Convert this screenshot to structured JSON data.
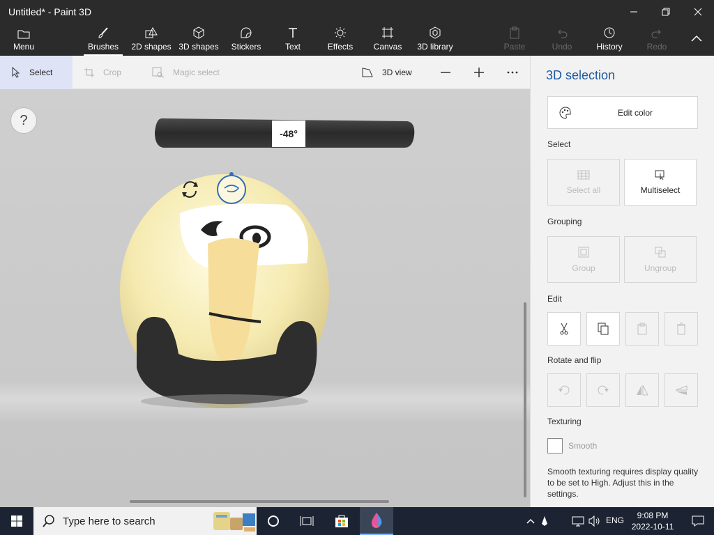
{
  "window": {
    "title": "Untitled* - Paint 3D"
  },
  "ribbon": {
    "menu": "Menu",
    "tools": [
      "Brushes",
      "2D shapes",
      "3D shapes",
      "Stickers",
      "Text",
      "Effects",
      "Canvas",
      "3D library"
    ],
    "actions": {
      "paste": "Paste",
      "undo": "Undo",
      "history": "History",
      "redo": "Redo"
    }
  },
  "toolbar": {
    "select": "Select",
    "crop": "Crop",
    "magic_select": "Magic select",
    "view_3d": "3D view"
  },
  "canvas": {
    "help": "?",
    "rotation_angle": "-48°"
  },
  "panel": {
    "title": "3D selection",
    "edit_color": "Edit color",
    "select_label": "Select",
    "select_all": "Select all",
    "multiselect": "Multiselect",
    "grouping_label": "Grouping",
    "group": "Group",
    "ungroup": "Ungroup",
    "edit_label": "Edit",
    "rotate_flip_label": "Rotate and flip",
    "texturing_label": "Texturing",
    "smooth": "Smooth",
    "smooth_note": "Smooth texturing requires display quality to be set to High. Adjust this in the settings."
  },
  "taskbar": {
    "search_placeholder": "Type here to search",
    "language": "ENG",
    "time": "9:08 PM",
    "date": "2022-10-11"
  },
  "colors": {
    "chrome_dark": "#2b2b2b",
    "accent_blue": "#1b5aa0",
    "panel_bg": "#f2f2f2",
    "taskbar": "#1c2433"
  }
}
